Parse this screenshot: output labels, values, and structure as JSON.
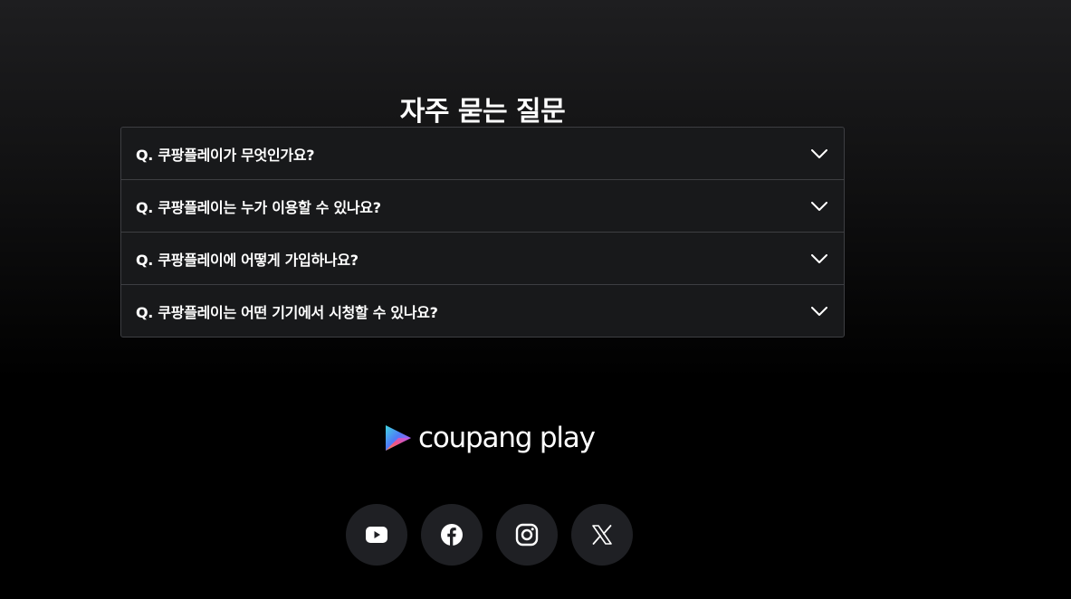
{
  "faq": {
    "title": "자주 묻는 질문",
    "items": [
      {
        "question": "Q. 쿠팡플레이가 무엇인가요?"
      },
      {
        "question": "Q. 쿠팡플레이는 누가 이용할 수 있나요?"
      },
      {
        "question": "Q. 쿠팡플레이에 어떻게 가입하나요?"
      },
      {
        "question": "Q. 쿠팡플레이는 어떤 기기에서 시청할 수 있나요?"
      }
    ]
  },
  "footer": {
    "logo_text": "coupang play",
    "social": [
      {
        "icon": "youtube-icon"
      },
      {
        "icon": "facebook-icon"
      },
      {
        "icon": "instagram-icon"
      },
      {
        "icon": "x-icon"
      }
    ]
  },
  "colors": {
    "background_top": "#1e1e20",
    "background_bottom": "#000000",
    "border": "#3d3e42",
    "social_button_bg": "#1f2024",
    "text": "#ffffff"
  }
}
